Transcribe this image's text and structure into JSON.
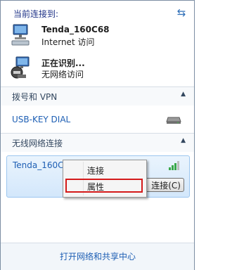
{
  "header": {
    "title": "当前连接到:"
  },
  "connections": [
    {
      "name": "Tenda_160C68",
      "status": "Internet 访问"
    },
    {
      "name": "正在识别...",
      "status": "无网络访问"
    }
  ],
  "sections": {
    "dialup_vpn": {
      "label": "拨号和 VPN",
      "expanded": true
    },
    "wireless": {
      "label": "无线网络连接",
      "expanded": true
    }
  },
  "vpn_items": [
    {
      "label": "USB-KEY DIAL"
    }
  ],
  "wifi_networks": [
    {
      "name": "Tenda_160C",
      "connect_label": "连接(C)"
    }
  ],
  "context_menu": {
    "items": [
      "连接",
      "属性"
    ],
    "highlighted": "属性"
  },
  "footer": {
    "link": "打开网络和共享中心"
  },
  "colors": {
    "link": "#1e5fb4",
    "highlight": "#d41a1a"
  }
}
